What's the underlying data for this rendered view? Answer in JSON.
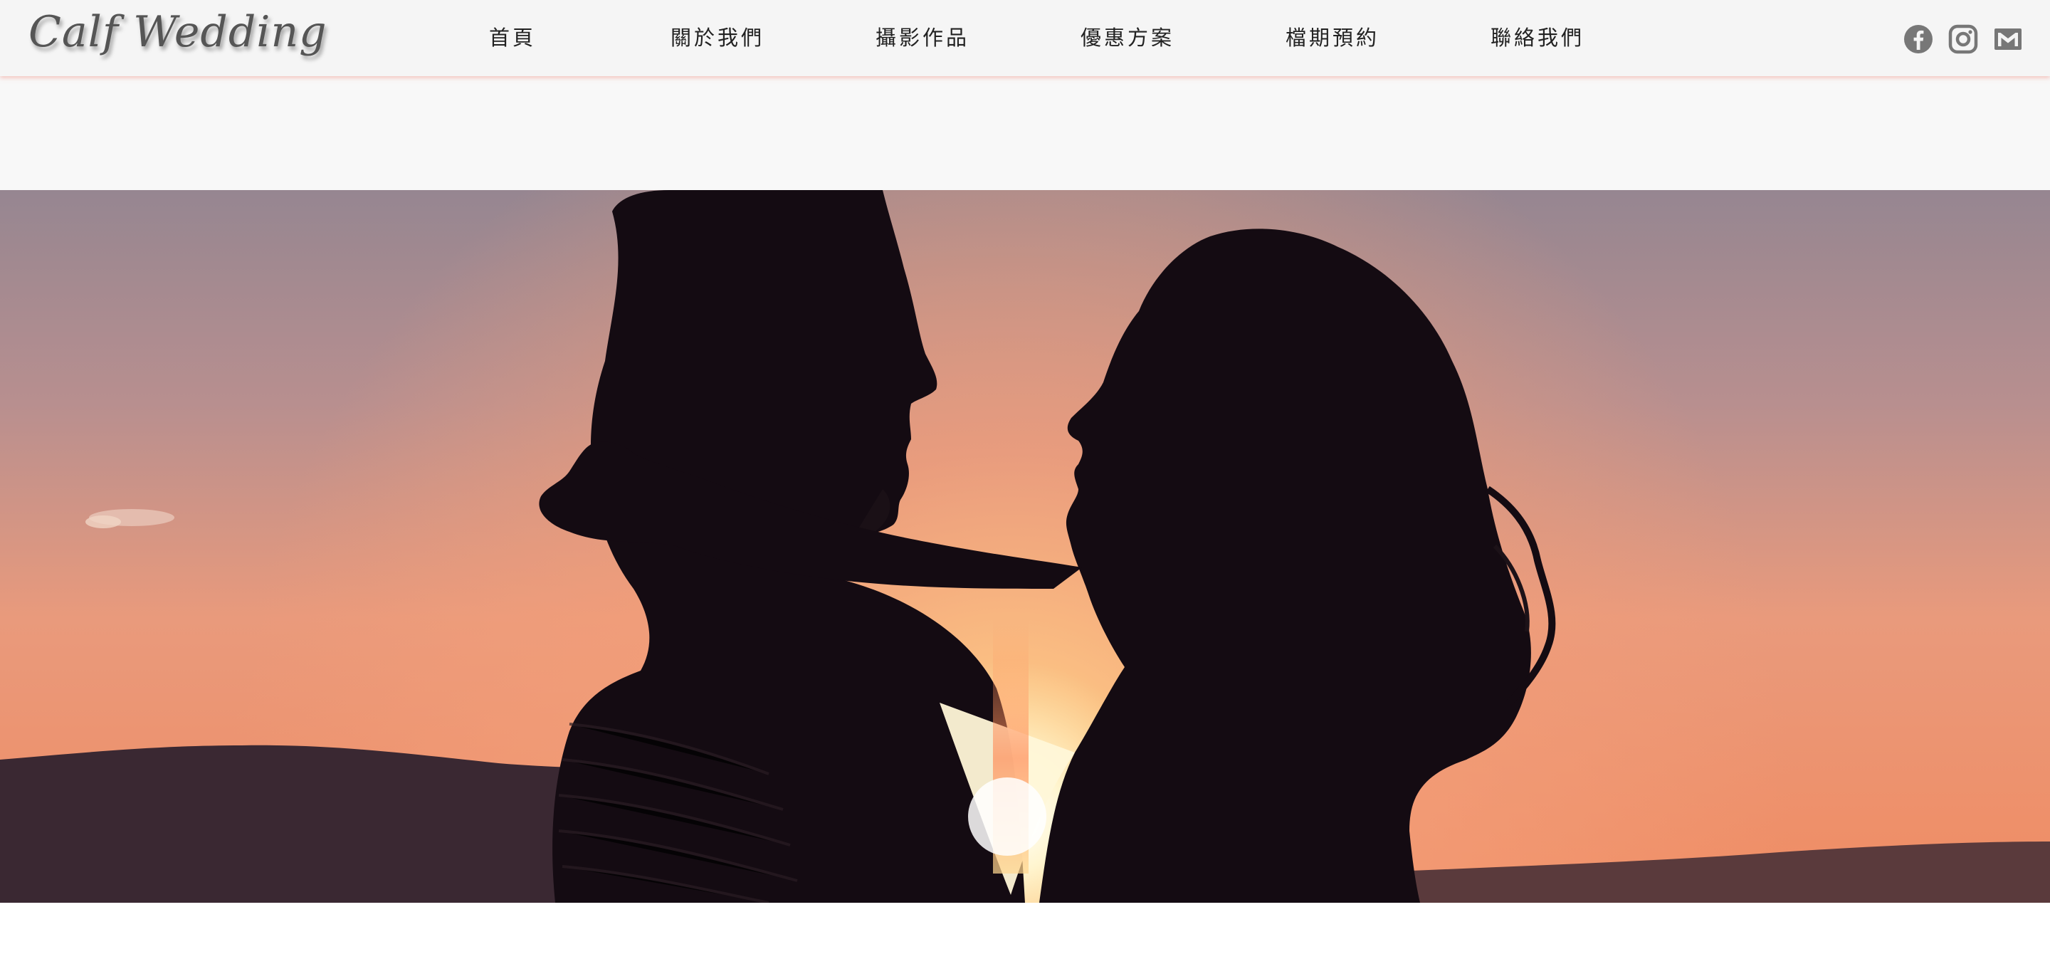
{
  "brand": {
    "logo_text": "Calf Wedding"
  },
  "nav": {
    "items": [
      {
        "label": "首頁",
        "name": "nav-home"
      },
      {
        "label": "關於我們",
        "name": "nav-about"
      },
      {
        "label": "攝影作品",
        "name": "nav-portfolio"
      },
      {
        "label": "優惠方案",
        "name": "nav-offers"
      },
      {
        "label": "檔期預約",
        "name": "nav-booking"
      },
      {
        "label": "聯絡我們",
        "name": "nav-contact"
      }
    ]
  },
  "social": {
    "icons": [
      "facebook-icon",
      "instagram-icon",
      "email-icon"
    ],
    "icon_color": "#777777"
  },
  "hero": {
    "image": "couple-silhouette-sunset",
    "colors": {
      "sky_top": "#9a8590",
      "sky_glow": "#f4a87e",
      "sun": "#fff6d8",
      "mountain": "#3b2a33",
      "silhouette": "#120a10"
    }
  },
  "theme": {
    "navbar_bg": "#f5f5f5",
    "navbar_shadow": "#ee8c82",
    "text": "#222222"
  }
}
